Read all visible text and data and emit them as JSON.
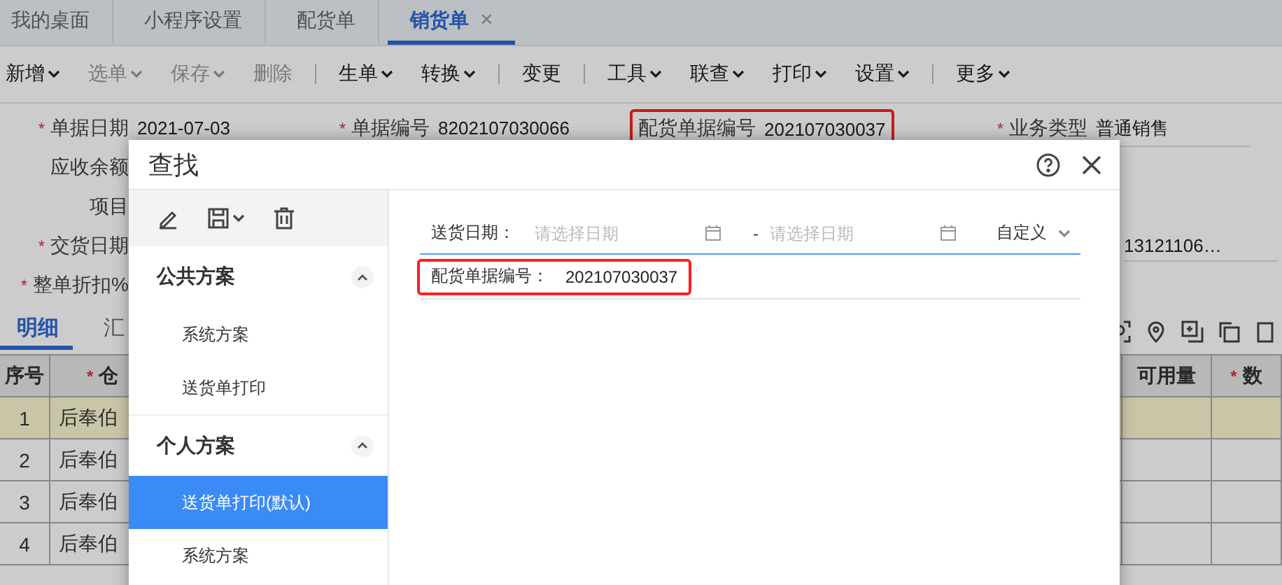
{
  "tabs": [
    {
      "label": "我的桌面",
      "selected": false
    },
    {
      "label": "小程序设置",
      "selected": false
    },
    {
      "label": "配货单",
      "selected": false
    },
    {
      "label": "销货单",
      "selected": true,
      "close": "×"
    }
  ],
  "toolbar": {
    "groups": [
      [
        {
          "label": "新增",
          "dropdown": true,
          "disabled": false
        },
        {
          "label": "选单",
          "dropdown": true,
          "disabled": true
        },
        {
          "label": "保存",
          "dropdown": true,
          "disabled": true
        },
        {
          "label": "删除",
          "dropdown": false,
          "disabled": true
        }
      ],
      [
        {
          "label": "生单",
          "dropdown": true,
          "disabled": false
        },
        {
          "label": "转换",
          "dropdown": true,
          "disabled": false
        }
      ],
      [
        {
          "label": "变更",
          "dropdown": false,
          "disabled": false
        }
      ],
      [
        {
          "label": "工具",
          "dropdown": true,
          "disabled": false
        },
        {
          "label": "联查",
          "dropdown": true,
          "disabled": false
        },
        {
          "label": "打印",
          "dropdown": true,
          "disabled": false
        },
        {
          "label": "设置",
          "dropdown": true,
          "disabled": false
        }
      ],
      [
        {
          "label": "更多",
          "dropdown": true,
          "disabled": false
        }
      ]
    ]
  },
  "form": {
    "rows": [
      [
        {
          "label": "单据日期",
          "mark": "*",
          "value": "2021-07-03",
          "highlighted": false
        },
        {
          "label": "单据编号",
          "mark": "*",
          "value": "8202107030066",
          "highlighted": false
        },
        {
          "label": "配货单据编号",
          "value": "202107030037",
          "highlighted": true
        },
        {
          "label": "业务类型",
          "mark": "*",
          "value": "普通销售",
          "highlighted": false
        }
      ],
      [
        {
          "label": "应收余额",
          "highlighted": false
        }
      ],
      [
        {
          "label": "项目",
          "highlighted": false
        }
      ],
      [
        {
          "label": "交货日期",
          "mark": "*",
          "highlighted": false
        },
        null,
        null,
        {
          "value": "13121106…",
          "highlighted": false
        }
      ],
      [
        {
          "label": "整单折扣%",
          "mark": "*",
          "highlighted": false
        }
      ]
    ]
  },
  "detail_tabs": [
    {
      "label": "明细",
      "selected": true
    },
    {
      "label": "汇",
      "selected": false
    }
  ],
  "table": {
    "columns": [
      {
        "label": "序号"
      },
      {
        "label": "仓",
        "mark": "*"
      },
      null,
      {
        "label": "可用量"
      },
      {
        "label": "数",
        "mark": "*"
      }
    ],
    "rows": [
      {
        "index": "1",
        "warehouse": "后奉伯",
        "selected": true
      },
      {
        "index": "2",
        "warehouse": "后奉伯",
        "selected": false
      },
      {
        "index": "3",
        "warehouse": "后奉伯",
        "selected": false
      },
      {
        "index": "4",
        "warehouse": "后奉伯",
        "selected": false
      }
    ]
  },
  "dialog": {
    "title": "查找",
    "scheme_groups": [
      {
        "title": "公共方案",
        "expanded": true,
        "items": [
          {
            "label": "系统方案",
            "selected": false
          },
          {
            "label": "送货单打印",
            "selected": false
          }
        ]
      },
      {
        "title": "个人方案",
        "expanded": true,
        "items": [
          {
            "label": "送货单打印(默认)",
            "selected": true
          },
          {
            "label": "系统方案",
            "selected": false
          }
        ]
      }
    ],
    "filters": [
      {
        "kind": "date_range",
        "label": "送货日期：",
        "start_placeholder": "请选择日期",
        "separator": "-",
        "end_placeholder": "请选择日期",
        "mode": "自定义",
        "focused": true
      },
      {
        "kind": "text",
        "label": "配货单据编号：",
        "value": "202107030037",
        "highlighted": true,
        "focused": false
      }
    ]
  }
}
